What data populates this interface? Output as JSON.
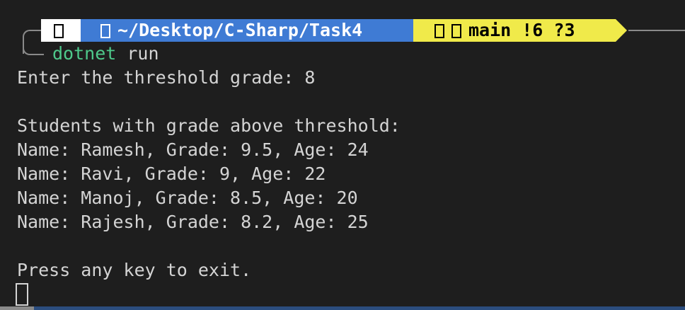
{
  "prompt": {
    "os_icon": "apple-icon",
    "folder_icon": "folder-icon",
    "path": "~/Desktop/C-Sharp/Task4",
    "git_icons": [
      "git-icon",
      "branch-icon"
    ],
    "branch_status": "main !6 ?3",
    "colors": {
      "os_segment": "#ffffff",
      "path_segment": "#3f7bd4",
      "git_segment": "#f0ea4a"
    }
  },
  "command": {
    "executable": "dotnet",
    "args": "run"
  },
  "output": [
    "Enter the threshold grade: 8",
    "",
    "Students with grade above threshold:",
    "Name: Ramesh, Grade: 9.5, Age: 24",
    "Name: Ravi, Grade: 9, Age: 22",
    "Name: Manoj, Grade: 8.5, Age: 20",
    "Name: Rajesh, Grade: 8.2, Age: 25",
    "",
    "Press any key to exit."
  ]
}
